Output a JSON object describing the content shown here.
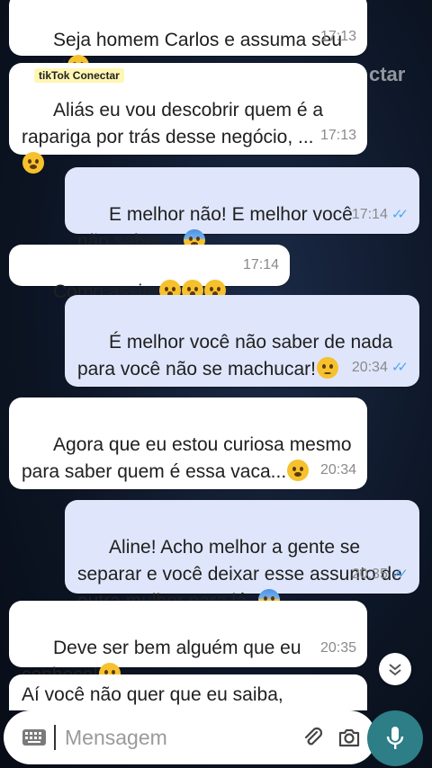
{
  "watermark": {
    "tag": "tikTok Conectar",
    "bg_text": "ctar"
  },
  "messages": [
    {
      "dir": "in",
      "text": "Seja homem Carlos e assuma seu caso!",
      "emoji": "angry-face",
      "time": "17:13"
    },
    {
      "dir": "in",
      "text": "Aliás eu vou descobrir quem é a rapariga por trás desse negócio, ...",
      "emoji": "angry-face",
      "time": "17:13"
    },
    {
      "dir": "out",
      "text": "E melhor não! E melhor você não saber ...",
      "emoji": "anxious-face",
      "time": "17:14",
      "status": "read"
    },
    {
      "dir": "in",
      "text": "Como assim",
      "emoji": "astonished-face x3",
      "time": "17:14"
    },
    {
      "dir": "out",
      "text": "É melhor você não saber de nada para você não se machucar!",
      "emoji": "pensive-face",
      "time": "20:34",
      "status": "read"
    },
    {
      "dir": "in",
      "text": "Agora que eu estou curiosa mesmo para saber quem é essa vaca...",
      "emoji": "angry-face",
      "time": "20:34"
    },
    {
      "dir": "out",
      "text": "Aline! Acho melhor a gente se separar e você deixar esse assunto de outra mulher para lá..",
      "emoji": "anxious-face",
      "time": "20:35",
      "status": "read"
    },
    {
      "dir": "in",
      "text": "Deve ser bem alguém que eu conheço!",
      "emoji": "grimacing-face",
      "time": "20:35"
    },
    {
      "dir": "in",
      "text": "Aí você não quer que eu saiba,",
      "time": ""
    }
  ],
  "input": {
    "placeholder": "Mensagem"
  },
  "colors": {
    "incoming": "#ffffff",
    "outgoing": "#dfe6fb",
    "mic": "#2d7e86",
    "ticks": "#4fa6f0"
  }
}
